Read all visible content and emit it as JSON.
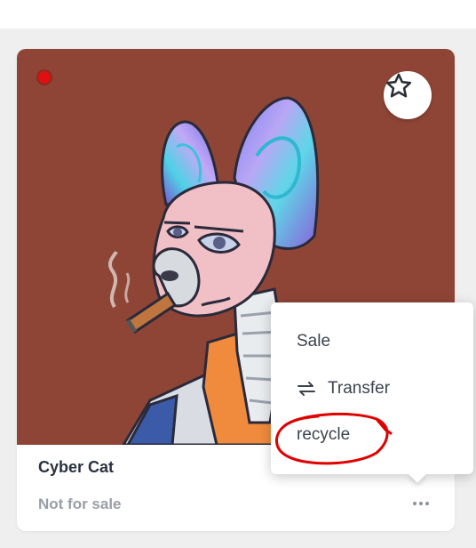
{
  "colors": {
    "artwork_background": "#8e4536",
    "status_dot": "#e01010",
    "annotation": "#e00000"
  },
  "card": {
    "title": "Cyber Cat",
    "sale_status": "Not for sale"
  },
  "icons": [
    "status-dot",
    "star-icon",
    "more-icon",
    "transfer-icon"
  ],
  "context_menu": {
    "items": [
      {
        "label": "Sale",
        "icon": ""
      },
      {
        "label": "Transfer",
        "icon": "transfer-icon"
      },
      {
        "label": "recycle",
        "icon": ""
      }
    ]
  }
}
